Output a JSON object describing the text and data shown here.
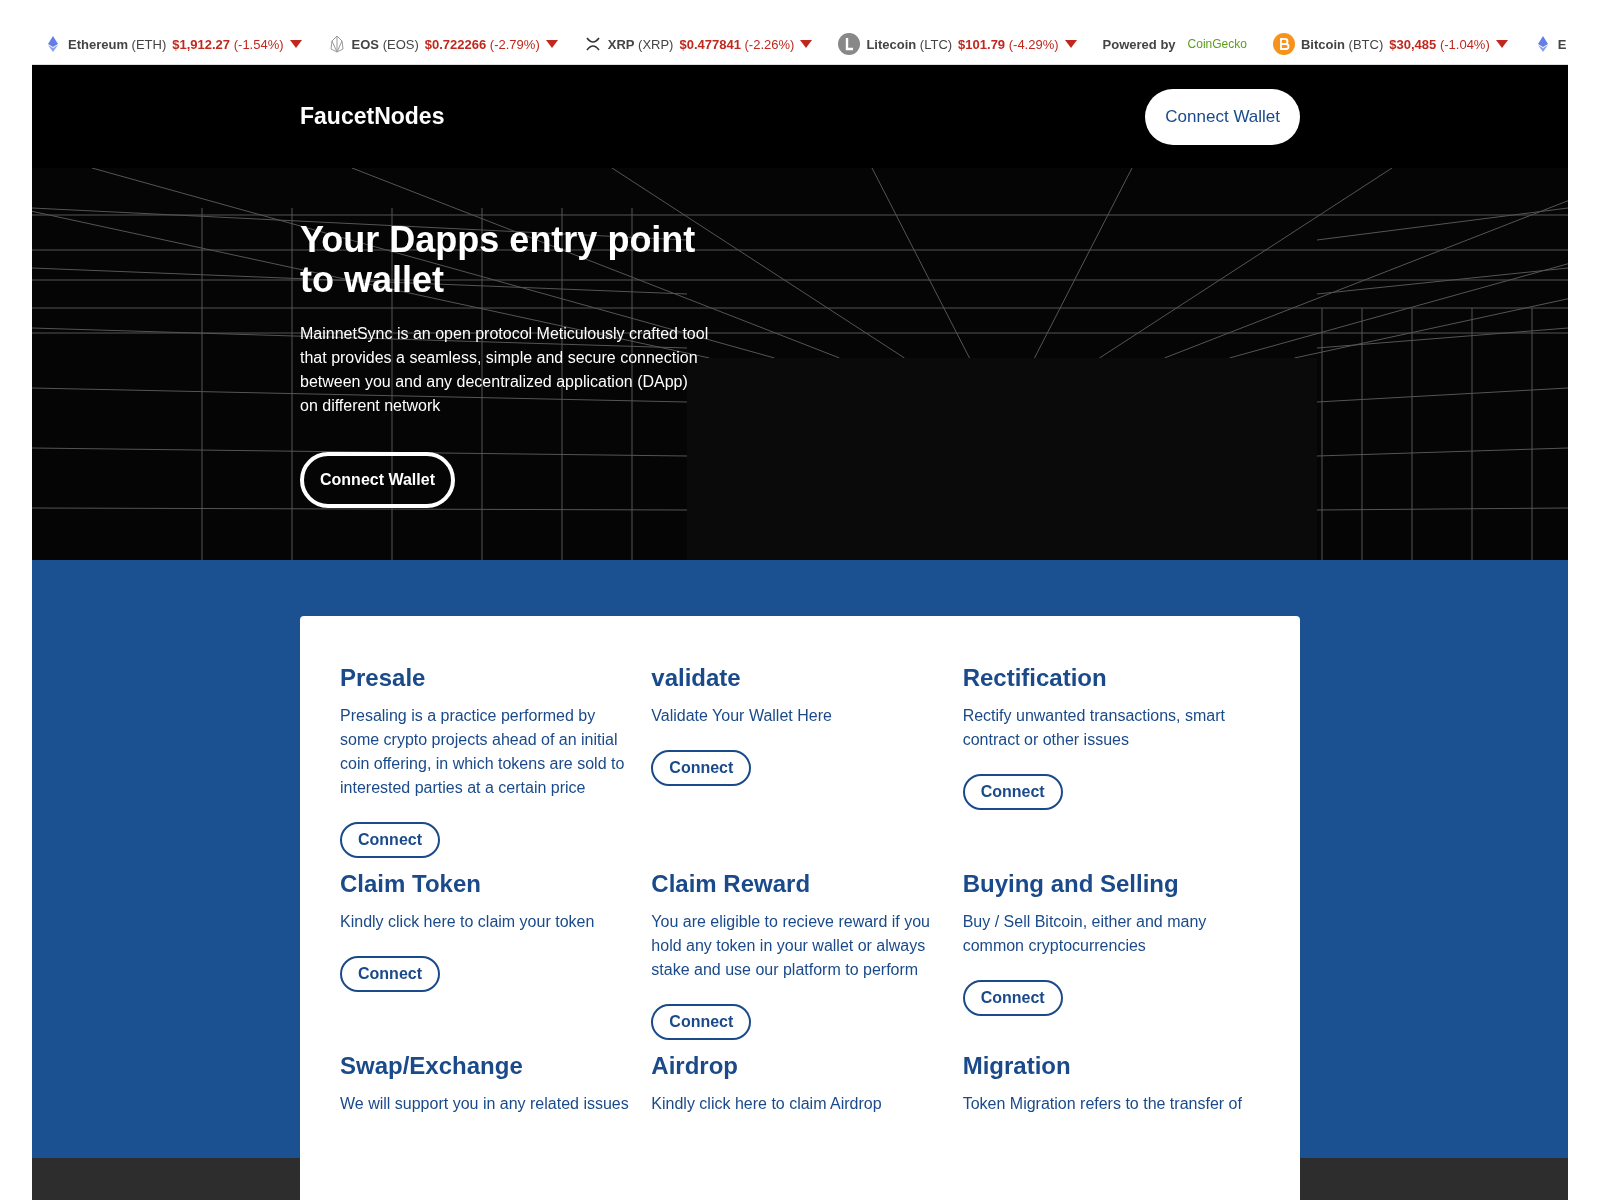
{
  "ticker": {
    "items": [
      {
        "kind": "eth",
        "name": "Ethereum",
        "symbol": "(ETH)",
        "price": "$1,912.27",
        "change": "(-1.54%)"
      },
      {
        "kind": "eos",
        "name": "EOS",
        "symbol": "(EOS)",
        "price": "$0.722266",
        "change": "(-2.79%)"
      },
      {
        "kind": "xrp",
        "name": "XRP",
        "symbol": "(XRP)",
        "price": "$0.477841",
        "change": "(-2.26%)"
      },
      {
        "kind": "ltc",
        "name": "Litecoin",
        "symbol": "(LTC)",
        "price": "$101.79",
        "change": "(-4.29%)"
      },
      {
        "kind": "powered",
        "label": "Powered by",
        "brand": "CoinGecko"
      },
      {
        "kind": "btc",
        "name": "Bitcoin",
        "symbol": "(BTC)",
        "price": "$30,485",
        "change": "(-1.04%)"
      },
      {
        "kind": "eth",
        "name": "E"
      }
    ]
  },
  "header": {
    "brand": "FaucetNodes",
    "button": "Connect Wallet"
  },
  "hero": {
    "title": "Your Dapps entry point to wallet",
    "text": "MainnetSync is an open protocol Meticulously crafted tool that provides a seamless, simple and secure connection between you and any decentralized application (DApp) on different network",
    "button": "Connect Wallet"
  },
  "services": [
    {
      "title": "Presale",
      "text": "Presaling is a practice performed by some crypto projects ahead of an initial coin offering, in which tokens are sold to interested parties at a certain price",
      "button": "Connect"
    },
    {
      "title": "validate",
      "text": "Validate Your Wallet Here",
      "button": "Connect"
    },
    {
      "title": "Rectification",
      "text": "Rectify unwanted transactions, smart contract or other issues",
      "button": "Connect"
    },
    {
      "title": "Claim Token",
      "text": "Kindly click here to claim your token",
      "button": "Connect"
    },
    {
      "title": "Claim Reward",
      "text": "You are eligible to recieve reward if you hold any token in your wallet or always stake and use our platform to perform",
      "button": "Connect"
    },
    {
      "title": "Buying and Selling",
      "text": "Buy / Sell Bitcoin, either and many common cryptocurrencies",
      "button": "Connect"
    },
    {
      "title": "Swap/Exchange",
      "text": "We will support you in any related issues"
    },
    {
      "title": "Airdrop",
      "text": "Kindly click here to claim Airdrop"
    },
    {
      "title": "Migration",
      "text": "Token Migration refers to the transfer of"
    }
  ]
}
